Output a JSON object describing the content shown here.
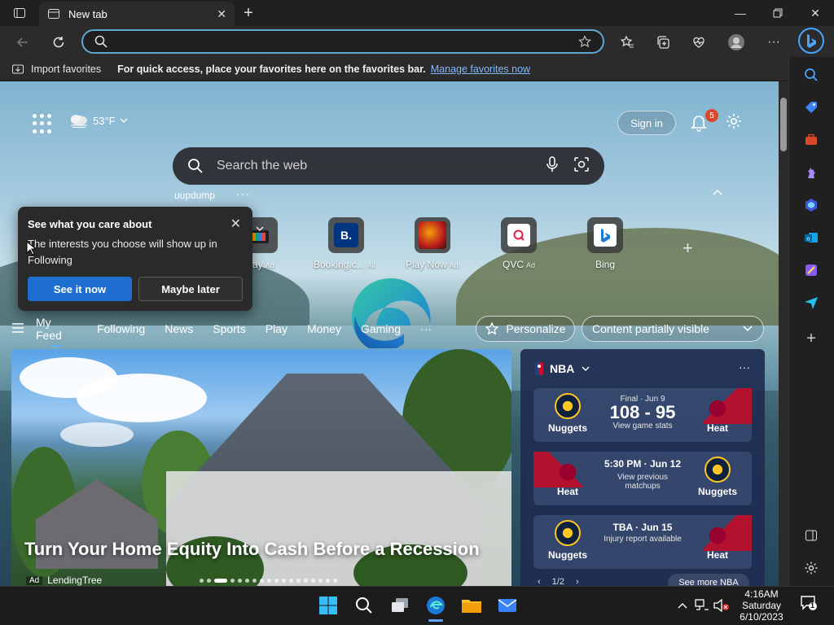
{
  "browser": {
    "tab_title": "New tab",
    "address_value": "",
    "favorites_bar": {
      "import_label": "Import favorites",
      "message": "For quick access, place your favorites here on the favorites bar.",
      "link": "Manage favorites now"
    }
  },
  "ntp": {
    "weather": "53°F",
    "sign_in": "Sign in",
    "notification_count": "5",
    "search_placeholder": "Search the web",
    "recent_search": "uupdump",
    "quick_links": [
      {
        "label": "Booking.c...",
        "ad": "All"
      },
      {
        "label": "Play Now",
        "ad": "Ad"
      },
      {
        "label": "QVC",
        "ad": "Ad"
      },
      {
        "label": "Bing",
        "ad": ""
      }
    ],
    "partial_label": "ay",
    "partial_ad": "Ad",
    "popup": {
      "title": "See what you care about",
      "body": "The interests you choose will show up in Following",
      "primary": "See it now",
      "secondary": "Maybe later"
    },
    "feed_tabs": [
      "My Feed",
      "Following",
      "News",
      "Sports",
      "Play",
      "Money",
      "Gaming"
    ],
    "personalize": "Personalize",
    "content_visibility": "Content partially visible",
    "hero": {
      "title": "Turn Your Home Equity Into Cash Before a Recession",
      "ad_tag": "Ad",
      "sponsor": "LendingTree"
    },
    "nba": {
      "league": "NBA",
      "games": [
        {
          "left": "Nuggets",
          "right": "Heat",
          "line1": "Final · Jun 9",
          "score": "108 - 95",
          "line3": "View game stats"
        },
        {
          "left": "Heat",
          "right": "Nuggets",
          "line1": "5:30 PM · Jun 12",
          "score": "",
          "line3": "View previous matchups"
        },
        {
          "left": "Nuggets",
          "right": "Heat",
          "line1": "TBA · Jun 15",
          "score": "",
          "line3": "Injury report available"
        }
      ],
      "pager": "1/2",
      "see_more": "See more NBA"
    }
  },
  "taskbar": {
    "time": "4:16AM",
    "day": "Saturday",
    "date": "6/10/2023",
    "notification_count": "1"
  },
  "colors": {
    "accent": "#1f6fd1",
    "address_border": "#5fa8d3",
    "badge": "#d9482b"
  }
}
